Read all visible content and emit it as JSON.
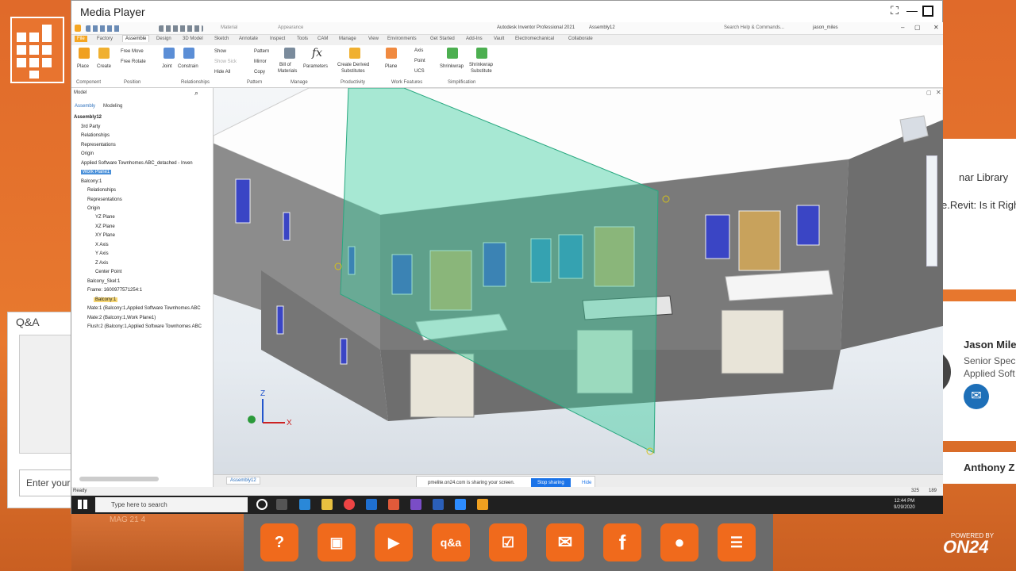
{
  "page": {
    "qa_title": "Q&A",
    "qa_placeholder": "Enter your",
    "library_text": "nar Library",
    "revit_text": "e.Revit: Is it Righ",
    "speaker_name": "Jason Miles",
    "speaker_title_1": "Senior Speci",
    "speaker_title_2": "Applied Soft",
    "speaker2_name": "Anthony Z",
    "city_text": "MAG 21 4",
    "powered_by": "POWERED BY",
    "brand": "ON24"
  },
  "media_player": {
    "title": "Media Player"
  },
  "inventor": {
    "app_title": "Autodesk Inventor Professional 2021",
    "doc_title": "Assembly12",
    "search_placeholder": "Search Help & Commands...",
    "user": "jason_miles",
    "qat_material": "Material",
    "qat_appearance": "Appearance",
    "tabs": [
      "File",
      "Factory",
      "Assemble",
      "Design",
      "3D Model",
      "Sketch",
      "Annotate",
      "Inspect",
      "Tools",
      "CAM",
      "Manage",
      "View",
      "Environments",
      "Get Started",
      "Add-Ins",
      "Vault",
      "Electromechanical",
      "Collaborate"
    ],
    "ribbon": {
      "place": "Place",
      "create": "Create",
      "free_move": "Free Move",
      "free_rotate": "Free Rotate",
      "joint": "Joint",
      "constrain": "Constrain",
      "show": "Show",
      "show_sick": "Show Sick",
      "hide_all": "Hide All",
      "pattern": "Pattern",
      "mirror": "Mirror",
      "copy": "Copy",
      "bom_1": "Bill of",
      "bom_2": "Materials",
      "parameters": "Parameters",
      "cds_1": "Create Derived",
      "cds_2": "Substitutes",
      "plane": "Plane",
      "axis": "Axis",
      "point": "Point",
      "ucs": "UCS",
      "shrinkwrap": "Shrinkwrap",
      "shrinkwrap2_1": "Shrinkwrap",
      "shrinkwrap2_2": "Substitute",
      "groups": [
        "Component",
        "Position",
        "Relationships",
        "Pattern",
        "Manage",
        "Productivity",
        "Work Features",
        "Simplification"
      ]
    },
    "browser": {
      "tab_model": "Model",
      "tab_assembly": "Assembly",
      "tab_modeling": "Modeling",
      "items": [
        "Assembly12",
        "3rd Party",
        "Relationships",
        "Representations",
        "Origin",
        "Applied Software Townhomes ABC_detached - Inven",
        "Work Plane1",
        "Balcony:1",
        "Relationships",
        "Representations",
        "Origin",
        "YZ Plane",
        "XZ Plane",
        "XY Plane",
        "X Axis",
        "Y Axis",
        "Z Axis",
        "Center Point",
        "Balcony_Skel:1",
        "Frame: 1600977571254:1",
        "Balcony:1",
        "Mate:1 (Balcony:1,Applied Software Townhomes ABC",
        "Mate:2 (Balcony:1,Work Plane1)",
        "Flush:2 (Balcony:1,Applied Software Townhomes ABC"
      ]
    },
    "doc_tab": "Assembly12",
    "share_text": "pmelite.on24.com is sharing your screen.",
    "stop_sharing": "Stop sharing",
    "hide": "Hide",
    "status": "Ready",
    "status_nums": [
      "325",
      "189"
    ],
    "axis_x": "X",
    "axis_z": "Z"
  },
  "taskbar": {
    "search": "Type here to search",
    "time": "12:44 PM",
    "date": "9/29/2020"
  },
  "bottom_icons": [
    "help-icon",
    "presentation-icon",
    "video-icon",
    "qa-icon",
    "survey-icon",
    "email-icon",
    "facebook-icon",
    "person-icon",
    "document-icon"
  ],
  "bottom_labels": {
    "help": "?",
    "qa": "q&a",
    "facebook": "f"
  }
}
